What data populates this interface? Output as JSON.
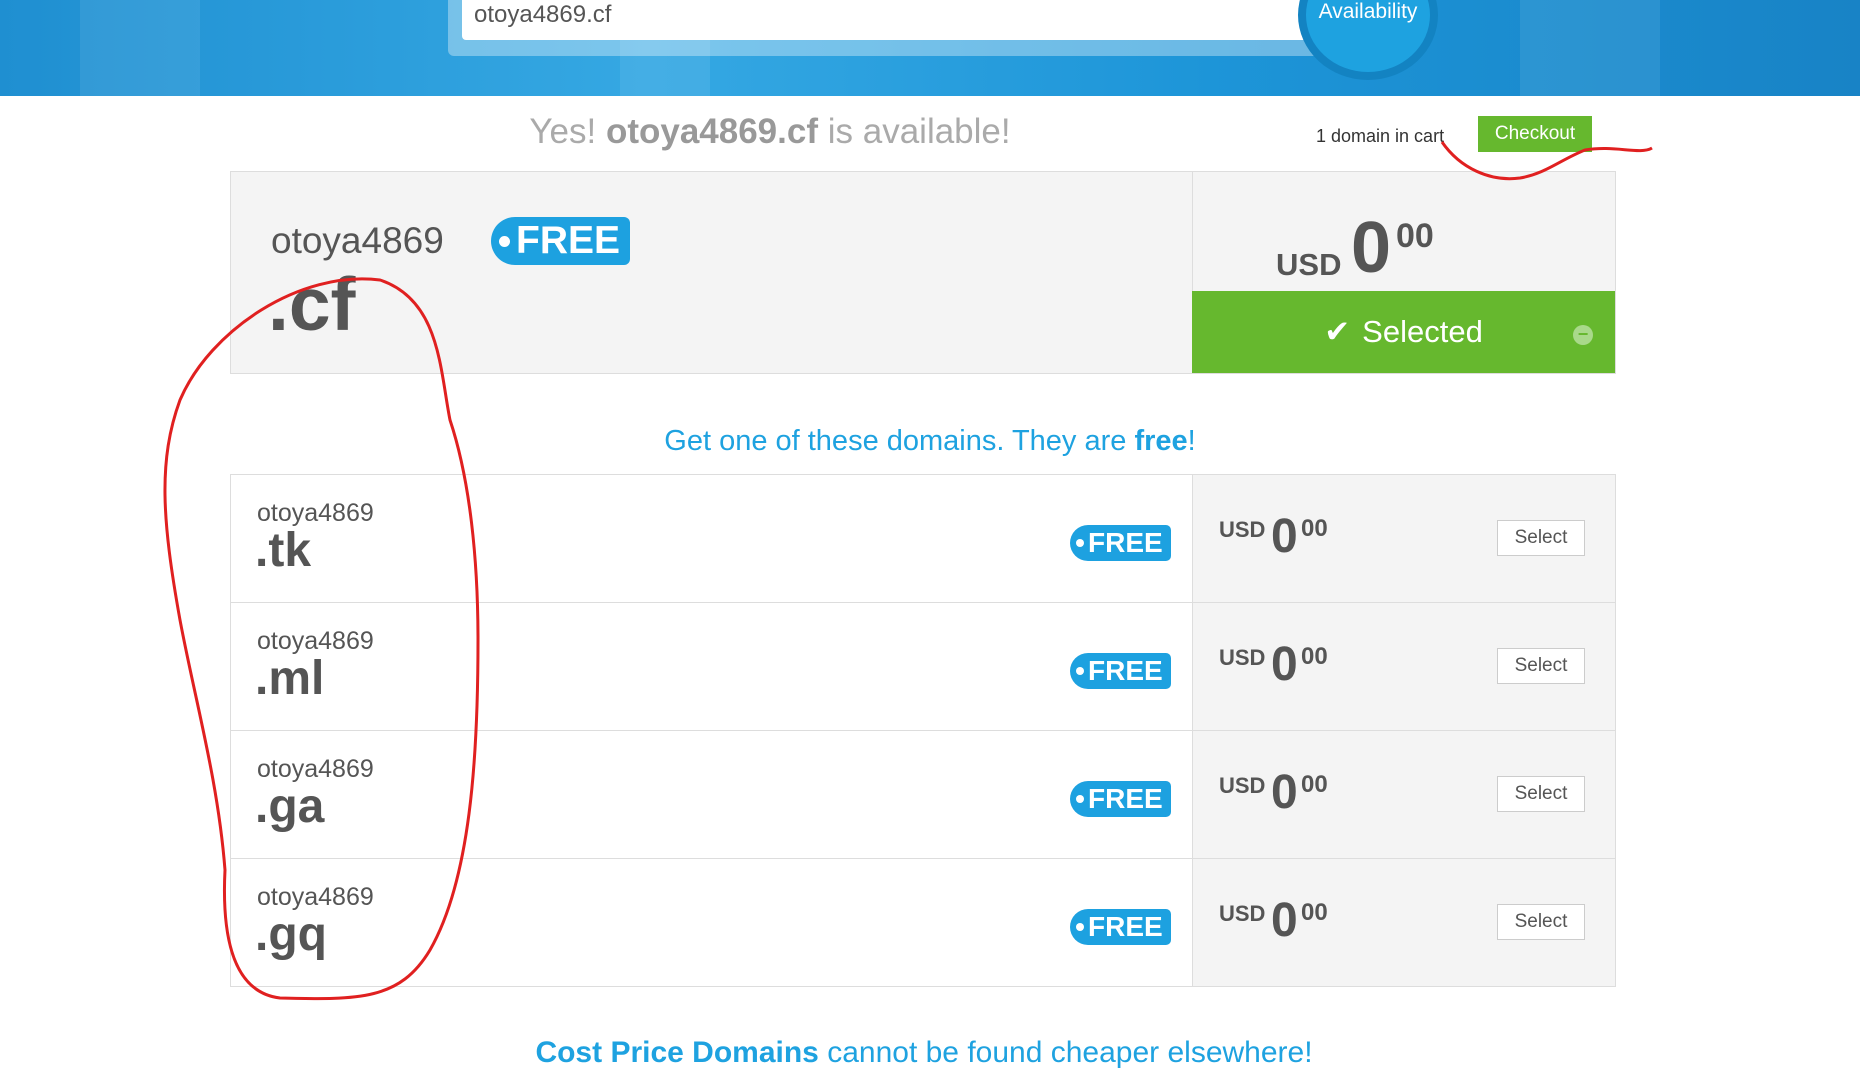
{
  "search": {
    "value": "otoya4869.cf",
    "button_label": "Availability"
  },
  "status": {
    "prefix": "Yes!",
    "domain": "otoya4869.cf",
    "suffix": "is available!"
  },
  "cart": {
    "count_text": "1 domain in cart",
    "checkout_label": "Checkout"
  },
  "main_domain": {
    "sld": "otoya4869",
    "tld": ".cf",
    "badge": "FREE",
    "currency": "USD",
    "price_int": "0",
    "price_dec": "00",
    "selected_label": "Selected"
  },
  "promo": {
    "text_a": "Get one of these domains. They are ",
    "text_b": "free",
    "text_c": "!"
  },
  "suggestions": [
    {
      "sld": "otoya4869",
      "tld": ".tk",
      "badge": "FREE",
      "currency": "USD",
      "price_int": "0",
      "price_dec": "00",
      "button": "Select"
    },
    {
      "sld": "otoya4869",
      "tld": ".ml",
      "badge": "FREE",
      "currency": "USD",
      "price_int": "0",
      "price_dec": "00",
      "button": "Select"
    },
    {
      "sld": "otoya4869",
      "tld": ".ga",
      "badge": "FREE",
      "currency": "USD",
      "price_int": "0",
      "price_dec": "00",
      "button": "Select"
    },
    {
      "sld": "otoya4869",
      "tld": ".gq",
      "badge": "FREE",
      "currency": "USD",
      "price_int": "0",
      "price_dec": "00",
      "button": "Select"
    }
  ],
  "footer": {
    "brand": "Cost Price Domains",
    "text": "cannot be found cheaper elsewhere!"
  },
  "colors": {
    "accent": "#1ea2e0",
    "success": "#66b82e",
    "annotation": "#e02020"
  },
  "icons": {
    "check": "check-icon",
    "minus": "minus-circle-icon"
  }
}
